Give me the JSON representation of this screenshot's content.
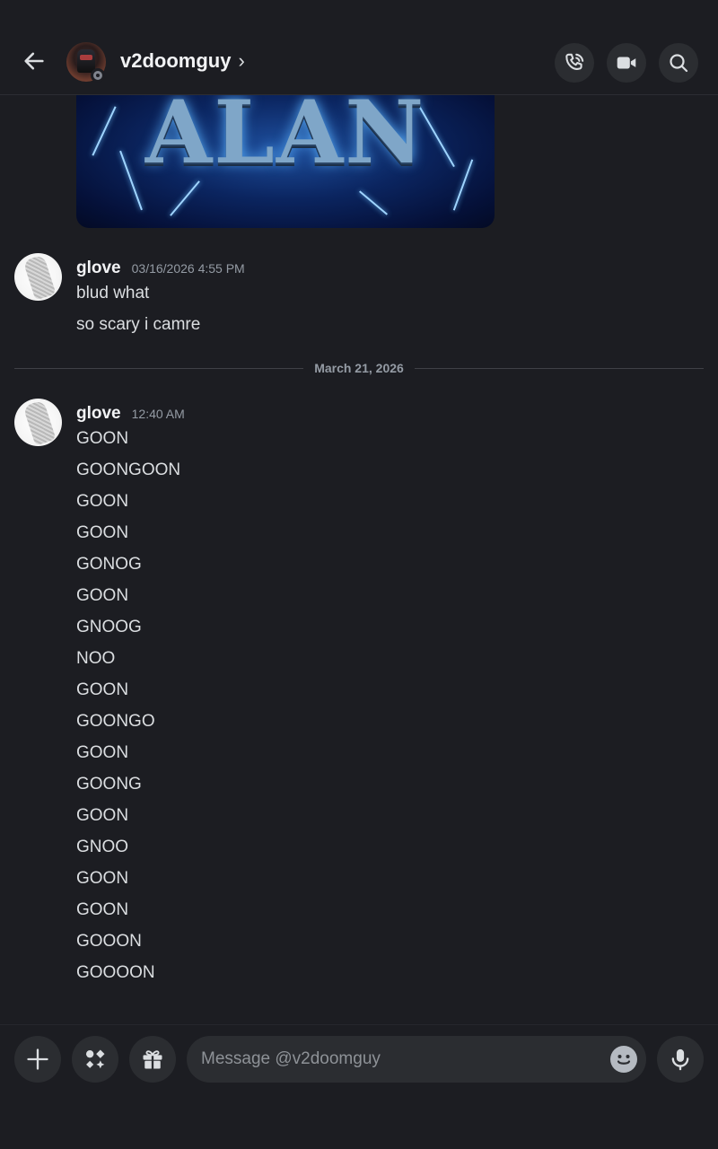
{
  "header": {
    "title": "v2doomguy",
    "chevron": "›",
    "icons": [
      "back-arrow-icon",
      "phone-call-icon",
      "video-camera-icon",
      "search-icon"
    ]
  },
  "attachment": {
    "image_text": "ALAN"
  },
  "messages": [
    {
      "author": "glove",
      "timestamp": "03/16/2026 4:55 PM",
      "lines": [
        "blud what",
        "so scary i camre"
      ]
    },
    {
      "author": "glove",
      "timestamp": "12:40 AM",
      "lines": [
        "GOON",
        "GOONGOON",
        "GOON",
        "GOON",
        "GONOG",
        "GOON",
        "GNOOG",
        "NOO",
        "GOON",
        "GOONGO",
        "GOON",
        "GOONG",
        "GOON",
        "GNOO",
        "GOON",
        "GOON",
        "GOOON",
        "GOOOON"
      ]
    }
  ],
  "date_divider": "March 21, 2026",
  "composer": {
    "placeholder": "Message @v2doomguy",
    "icons": [
      "plus-icon",
      "apps-icon",
      "gift-icon",
      "emoji-icon",
      "microphone-icon"
    ]
  }
}
